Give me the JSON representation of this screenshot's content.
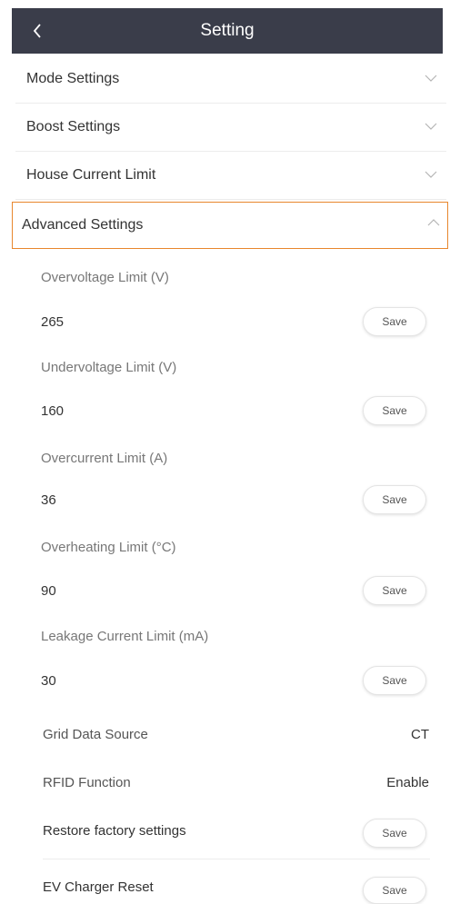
{
  "header": {
    "title": "Setting",
    "back_icon": "chevron-left-icon"
  },
  "sections": [
    {
      "label": "Mode Settings",
      "expanded": false
    },
    {
      "label": "Boost Settings",
      "expanded": false
    },
    {
      "label": "House Current Limit",
      "expanded": false
    },
    {
      "label": "Advanced Settings",
      "expanded": true
    }
  ],
  "colors": {
    "header_bg": "#3a3d4a",
    "active_border": "#e8872d"
  },
  "advanced": {
    "fields": [
      {
        "label": "Overvoltage Limit (V)",
        "value": "265",
        "button": "Save"
      },
      {
        "label": "Undervoltage Limit (V)",
        "value": "160",
        "button": "Save"
      },
      {
        "label": "Overcurrent Limit (A)",
        "value": "36",
        "button": "Save"
      },
      {
        "label": "Overheating Limit (°C)",
        "value": "90",
        "button": "Save"
      },
      {
        "label": "Leakage Current Limit (mA)",
        "value": "30",
        "button": "Save"
      }
    ],
    "grid_data_source": {
      "label": "Grid Data Source",
      "value": "CT"
    },
    "rfid_function": {
      "label": "RFID Function",
      "value": "Enable"
    },
    "restore_factory": {
      "label": "Restore factory settings",
      "button": "Save"
    },
    "ev_charger_reset": {
      "label": "EV Charger Reset",
      "button": "Save"
    }
  }
}
